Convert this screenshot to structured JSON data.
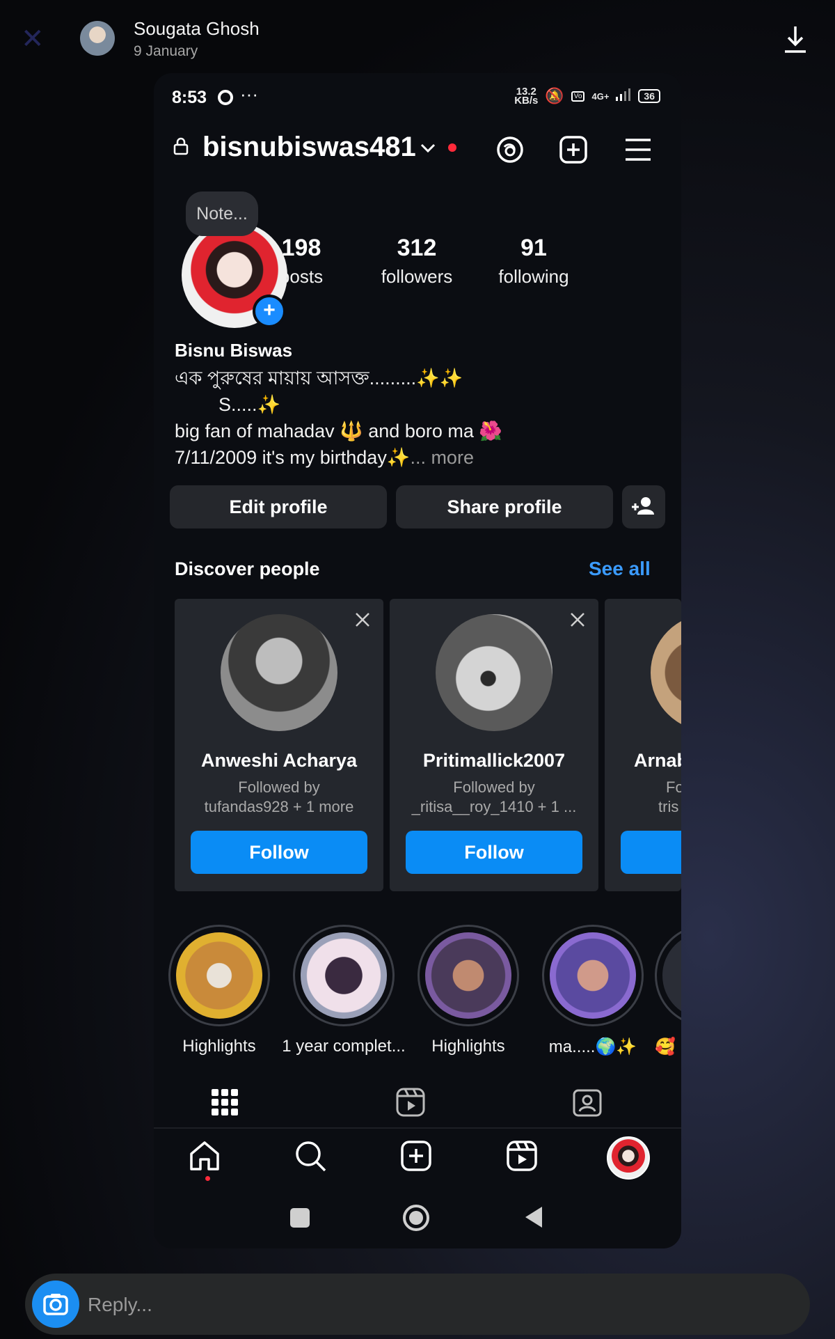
{
  "story_header": {
    "sender_name": "Sougata Ghosh",
    "date": "9 January"
  },
  "status_bar": {
    "time": "8:53",
    "speed_value": "13.2",
    "speed_unit": "KB/s",
    "network": "4G+",
    "battery": "36"
  },
  "profile": {
    "username": "bisnubiswas481",
    "note_placeholder": "Note...",
    "stats": [
      {
        "value": "198",
        "label": "posts"
      },
      {
        "value": "312",
        "label": "followers"
      },
      {
        "value": "91",
        "label": "following"
      }
    ],
    "display_name": "Bisnu Biswas",
    "bio_lines": [
      "এক পুরুষের মায়ায় আসক্ত.........✨✨",
      "S.....✨",
      "big fan of mahadav 🔱 and boro ma 🌺",
      "7/11/2009 it's my birthday✨"
    ],
    "bio_more": "... more"
  },
  "actions": {
    "edit_profile": "Edit profile",
    "share_profile": "Share profile"
  },
  "discover": {
    "title": "Discover people",
    "see_all": "See all",
    "cards": [
      {
        "name": "Anweshi Acharya",
        "line1": "Followed by",
        "line2": "tufandas928 + 1 more",
        "button": "Follow"
      },
      {
        "name": "Pritimallick2007",
        "line1": "Followed by",
        "line2": "_ritisa__roy_1410 + 1 ...",
        "button": "Follow"
      },
      {
        "name": "Arnab",
        "line1": "Fo",
        "line2": "tris",
        "button": ""
      }
    ]
  },
  "highlights": [
    {
      "label": "Highlights"
    },
    {
      "label": "1 year complet..."
    },
    {
      "label": "Highlights"
    },
    {
      "label": "ma.....🌍✨"
    },
    {
      "label": "🥰"
    }
  ],
  "reply": {
    "placeholder": "Reply..."
  },
  "colors": {
    "accent_blue": "#0a8cf5",
    "link_blue": "#3b9bff",
    "notification_red": "#ff2a3a"
  }
}
